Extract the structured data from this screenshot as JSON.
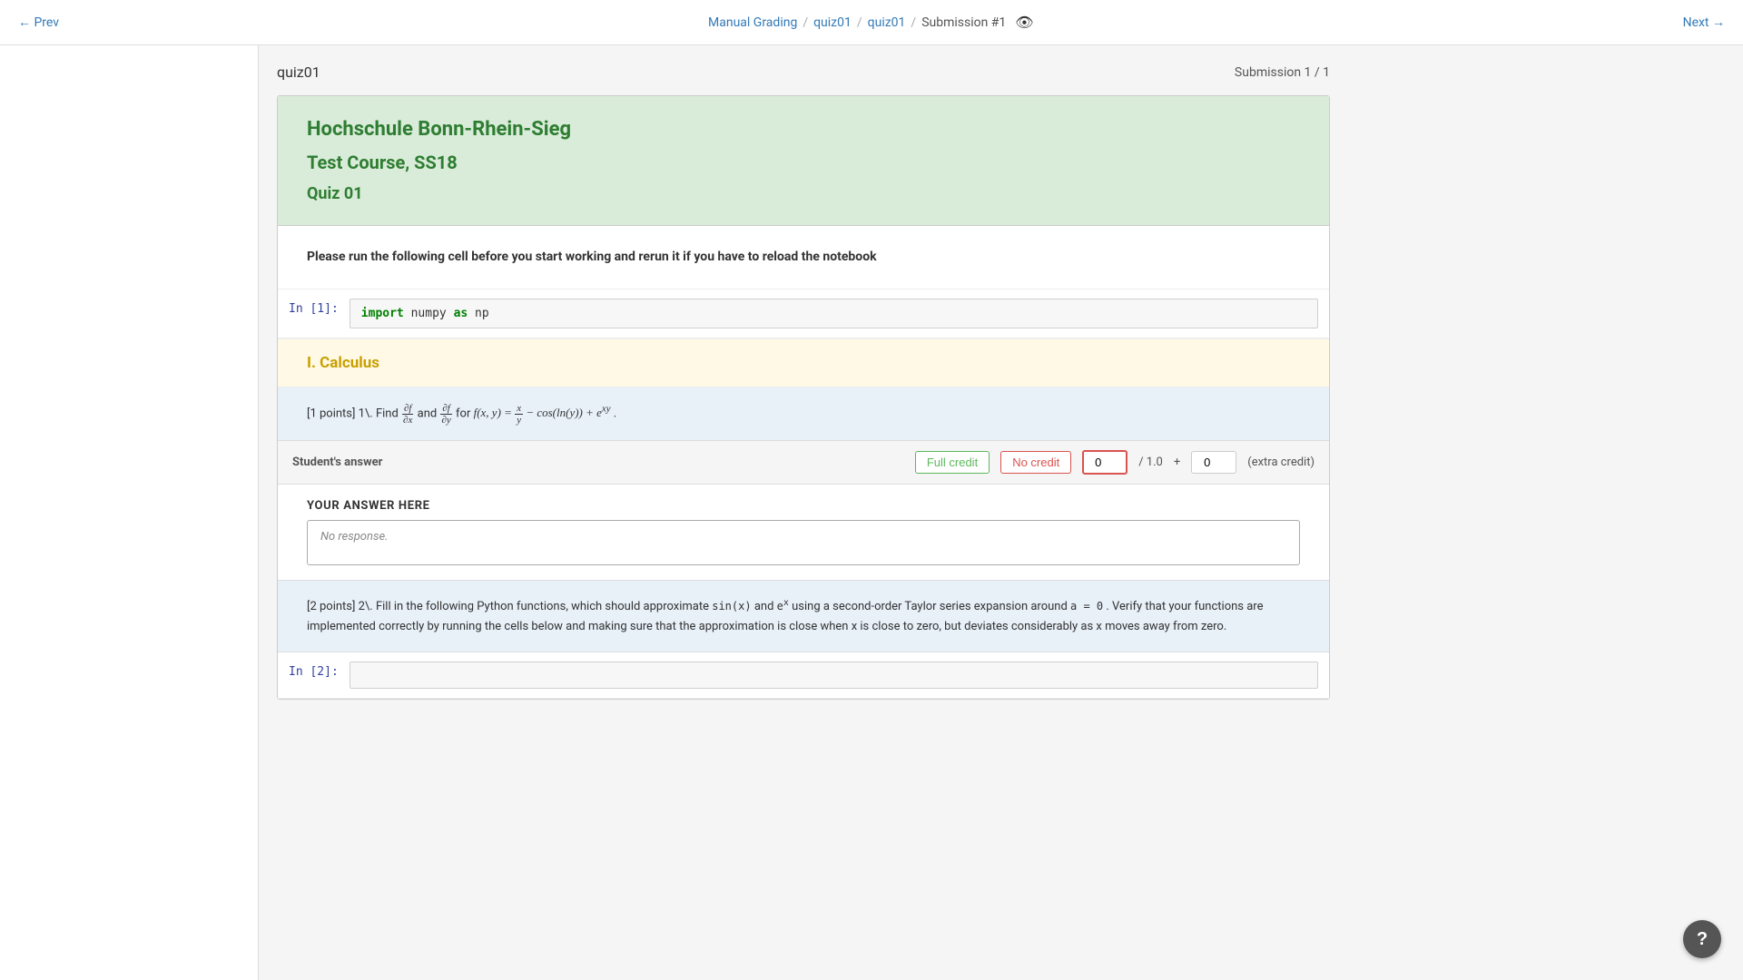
{
  "nav": {
    "prev_label": "← Prev",
    "next_label": "Next →",
    "breadcrumb": [
      {
        "label": "Manual Grading",
        "href": "#"
      },
      {
        "label": "quiz01",
        "href": "#"
      },
      {
        "label": "quiz01",
        "href": "#"
      },
      {
        "label": "Submission #1",
        "href": "#"
      }
    ],
    "has_eye_icon": true
  },
  "submission": {
    "quiz_name": "quiz01",
    "submission_text": "Submission 1 / 1"
  },
  "notebook": {
    "header": {
      "institution": "Hochschule Bonn-Rhein-Sieg",
      "course": "Test Course, SS18",
      "quiz": "Quiz 01"
    },
    "instructions": {
      "text": "Please run the following cell before you start working and rerun it if you have to reload the notebook"
    },
    "import_cell": {
      "prompt": "In [1]:",
      "code": "import numpy as np"
    },
    "section": {
      "label": "I. Calculus"
    },
    "question1": {
      "text_pre": "[1 points] 1\\. Find",
      "partial_fx": "∂f/∂x",
      "and": "and",
      "partial_fy": "∂f/∂y",
      "text_for": "for",
      "func_def": "f(x, y) = x/y − cos(ln(y)) + e^(xy)",
      "period": "."
    },
    "answer1": {
      "student_answer_label": "Student's answer",
      "full_credit_label": "Full credit",
      "no_credit_label": "No credit",
      "score_value": "0",
      "score_max": "1.0",
      "plus_label": "+",
      "extra_credit_value": "0",
      "extra_credit_label": "(extra credit)",
      "your_answer_label": "YOUR ANSWER HERE",
      "no_response_text": "No response."
    },
    "question2": {
      "text": "[2 points] 2\\. Fill in the following Python functions, which should approximate sin(x) and e^x using a second-order Taylor series expansion around a = 0. Verify that your functions are implemented correctly by running the cells below and making sure that the approximation is close when x is close to zero, but deviates considerably as x moves away from zero."
    },
    "import_cell2": {
      "prompt": "In [2]:",
      "code": ""
    }
  },
  "help_button": {
    "label": "?"
  }
}
